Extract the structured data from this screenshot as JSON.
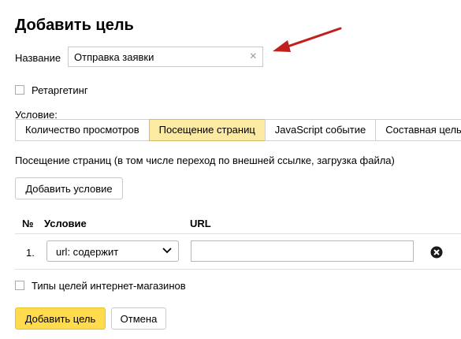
{
  "dialog": {
    "title": "Добавить цель"
  },
  "name_field": {
    "label": "Название",
    "value": "Отправка заявки"
  },
  "retargeting": {
    "label": "Ретаргетинг",
    "checked": false
  },
  "condition": {
    "label": "Условие:",
    "tabs": [
      {
        "label": "Количество просмотров",
        "active": false
      },
      {
        "label": "Посещение страниц",
        "active": true
      },
      {
        "label": "JavaScript событие",
        "active": false
      },
      {
        "label": "Составная цель",
        "active": false
      }
    ],
    "description": "Посещение страниц (в том числе переход по внешней ссылке, загрузка файла)",
    "add_button": "Добавить условие"
  },
  "table": {
    "headers": {
      "num": "№",
      "condition": "Условие",
      "url": "URL"
    },
    "rows": [
      {
        "num": "1.",
        "select_value": "url: содержит",
        "url_value": ""
      }
    ]
  },
  "shop_goals": {
    "label": "Типы целей интернет-магазинов",
    "checked": false
  },
  "footer": {
    "add": "Добавить цель",
    "cancel": "Отмена"
  },
  "annotation": {
    "arrow_color": "#c0201e"
  }
}
